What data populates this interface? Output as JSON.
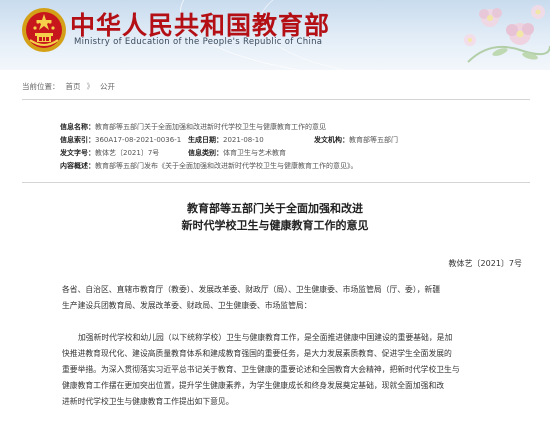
{
  "header": {
    "title_cn": "中华人民共和国教育部",
    "title_en": "Ministry of Education of the People's Republic of China"
  },
  "breadcrumb": {
    "current_label": "当前位置：",
    "home": "首页",
    "section": "公开",
    "separator": "》"
  },
  "meta": {
    "info_name_label": "信息名称：",
    "info_name": "教育部等五部门关于全面加强和改进新时代学校卫生与健康教育工作的意见",
    "index_label": "信息索引：",
    "index": "360A17-08-2021-0036-1",
    "date_label": "生成日期：",
    "date": "2021-08-10",
    "issuer_label": "发文机构：",
    "issuer": "教育部等五部门",
    "docno_label": "发文字号：",
    "docno": "教体艺〔2021〕7号",
    "category_label": "信息类别：",
    "category": "体育卫生与艺术教育",
    "summary_label": "内容概述：",
    "summary": "教育部等五部门发布《关于全面加强和改进新时代学校卫生与健康教育工作的意见》。"
  },
  "article": {
    "title_line1": "教育部等五部门关于全面加强和改进",
    "title_line2": "新时代学校卫生与健康教育工作的意见",
    "doc_number": "教体艺〔2021〕7号",
    "recipients_line1": "各省、自治区、直辖市教育厅（教委）、发展改革委、财政厅（局）、卫生健康委、市场监管局（厅、委），新疆",
    "recipients_line2": "生产建设兵团教育局、发展改革委、财政局、卫生健康委、市场监管局：",
    "body_lines": [
      "加强新时代学校和幼儿园（以下统称学校）卫生与健康教育工作，是全面推进健康中国建设的重要基础，是加",
      "快推进教育现代化、建设高质量教育体系和建成教育强国的重要任务，是大力发展素质教育、促进学生全面发展的",
      "重要举措。为深入贯彻落实习近平总书记关于教育、卫生健康的重要论述和全国教育大会精神，把新时代学校卫生与",
      "健康教育工作摆在更加突出位置，提升学生健康素养，为学生健康成长和终身发展奠定基础，现就全面加强和改",
      "进新时代学校卫生与健康教育工作提出如下意见。"
    ]
  }
}
